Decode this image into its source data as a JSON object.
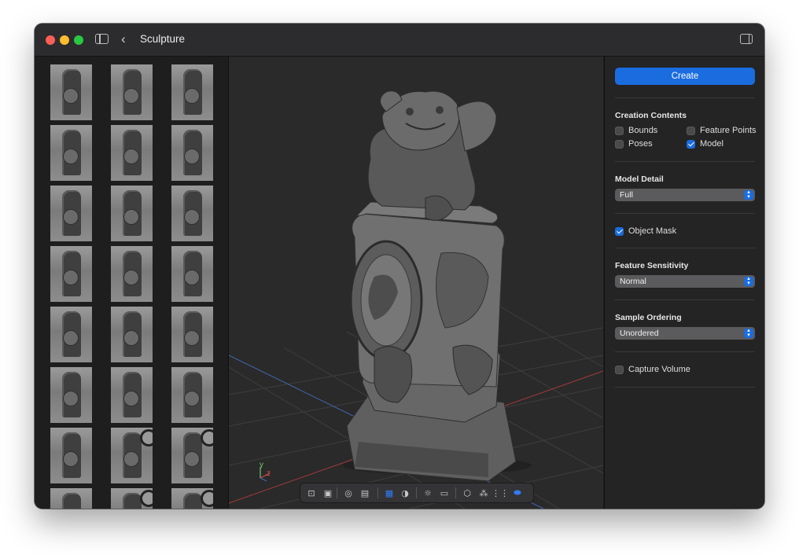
{
  "window": {
    "title": "Sculpture"
  },
  "colors": {
    "accent": "#1a6cdf",
    "close": "#ff5f57",
    "minimize": "#febc2e",
    "zoom": "#28c840"
  },
  "thumbnails": {
    "rows": 8,
    "columns": 3
  },
  "viewport": {
    "axis_labels": {
      "y": "y",
      "z": "z"
    },
    "toolbar": [
      {
        "icon": "frame-icon",
        "glyph": "⊡"
      },
      {
        "icon": "portrait-icon",
        "glyph": "▣"
      },
      {
        "icon": "circle-frame-icon",
        "glyph": "◎"
      },
      {
        "icon": "photo-stack-icon",
        "glyph": "▤"
      },
      {
        "icon": "grid-icon",
        "glyph": "▦",
        "active": true
      },
      {
        "icon": "contrast-icon",
        "glyph": "◑"
      },
      {
        "icon": "light-icon",
        "glyph": "☼"
      },
      {
        "icon": "rectangle-icon",
        "glyph": "▭"
      },
      {
        "icon": "cube-icon",
        "glyph": "⬡"
      },
      {
        "icon": "points-icon",
        "glyph": "⁂"
      },
      {
        "icon": "dot-grid-icon",
        "glyph": "⋮⋮"
      },
      {
        "icon": "platform-icon",
        "glyph": "⬬",
        "active": true
      }
    ]
  },
  "inspector": {
    "create_label": "Create",
    "creation_contents": {
      "label": "Creation Contents",
      "bounds": "Bounds",
      "feature_points": "Feature Points",
      "poses": "Poses",
      "model": "Model",
      "checked": {
        "bounds": false,
        "feature_points": false,
        "poses": false,
        "model": true
      }
    },
    "model_detail": {
      "label": "Model Detail",
      "value": "Full"
    },
    "object_mask": {
      "label": "Object Mask",
      "checked": true
    },
    "feature_sensitivity": {
      "label": "Feature Sensitivity",
      "value": "Normal"
    },
    "sample_ordering": {
      "label": "Sample Ordering",
      "value": "Unordered"
    },
    "capture_volume": {
      "label": "Capture Volume",
      "checked": false
    }
  }
}
